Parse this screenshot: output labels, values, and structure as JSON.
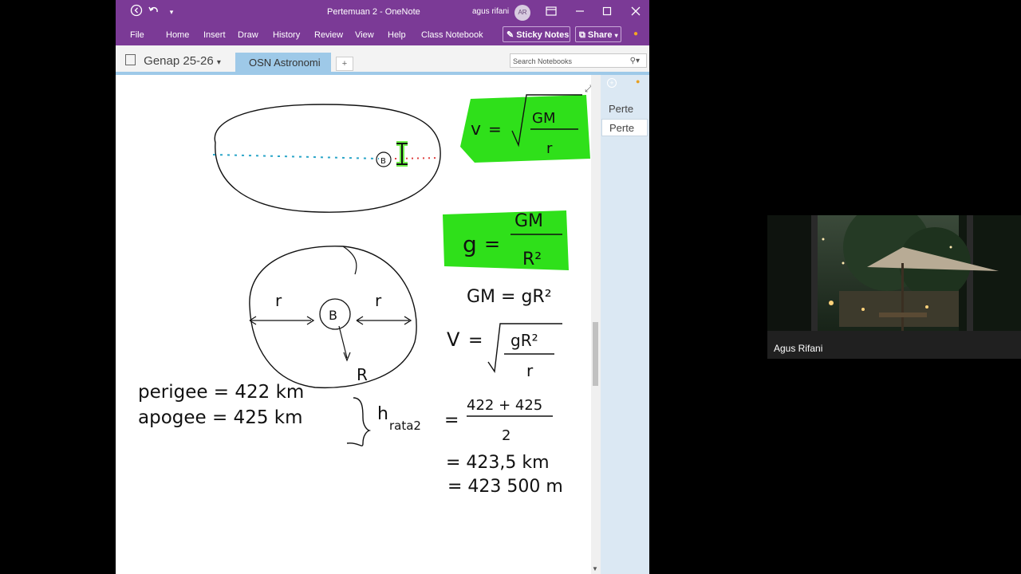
{
  "window": {
    "title": "Pertemuan 2  -  OneNote",
    "user": "agus rifani",
    "avatar": "AR",
    "icons": [
      "back-icon",
      "undo-icon",
      "quick-access-icon",
      "fullscreen-icon",
      "minimize-icon",
      "maximize-icon",
      "close-icon"
    ]
  },
  "ribbon": {
    "file": "File",
    "tabs": [
      "Home",
      "Insert",
      "Draw",
      "History",
      "Review",
      "View",
      "Help",
      "Class Notebook"
    ],
    "sticky_notes": "Sticky Notes",
    "share": "Share"
  },
  "notebook": {
    "name": "Genap 25-26",
    "section": "OSN Astronomi",
    "add_tab": "+",
    "search_placeholder": "Search Notebooks"
  },
  "pages": {
    "items": [
      "Perte",
      "Perte"
    ],
    "add_icon": "add-page-icon"
  },
  "notes": {
    "formula_v": {
      "lhs": "v",
      "num": "GM",
      "den": "r"
    },
    "formula_g": {
      "lhs": "g",
      "num": "GM",
      "den": "R²"
    },
    "gm_eq": "GM = gR²",
    "v_eq": {
      "lhs": "V",
      "num": "gR²",
      "den": "r"
    },
    "circle_labels": {
      "r": "r",
      "b": "B",
      "R": "R"
    },
    "perigee": "perigee = 422 km",
    "apogee": "apogee = 425 km",
    "h_label": "h",
    "h_sub": "rata2",
    "h_num": "422 + 425",
    "h_den": "2",
    "result1": "= 423,5 km",
    "result2": "= 423 500 m"
  },
  "video": {
    "name": "Agus Rifani"
  },
  "colors": {
    "onenote_purple": "#7b3a96",
    "highlight": "#2fe01a",
    "tab_blue": "#9ec9e8",
    "pages_bg": "#dbe8f3"
  }
}
